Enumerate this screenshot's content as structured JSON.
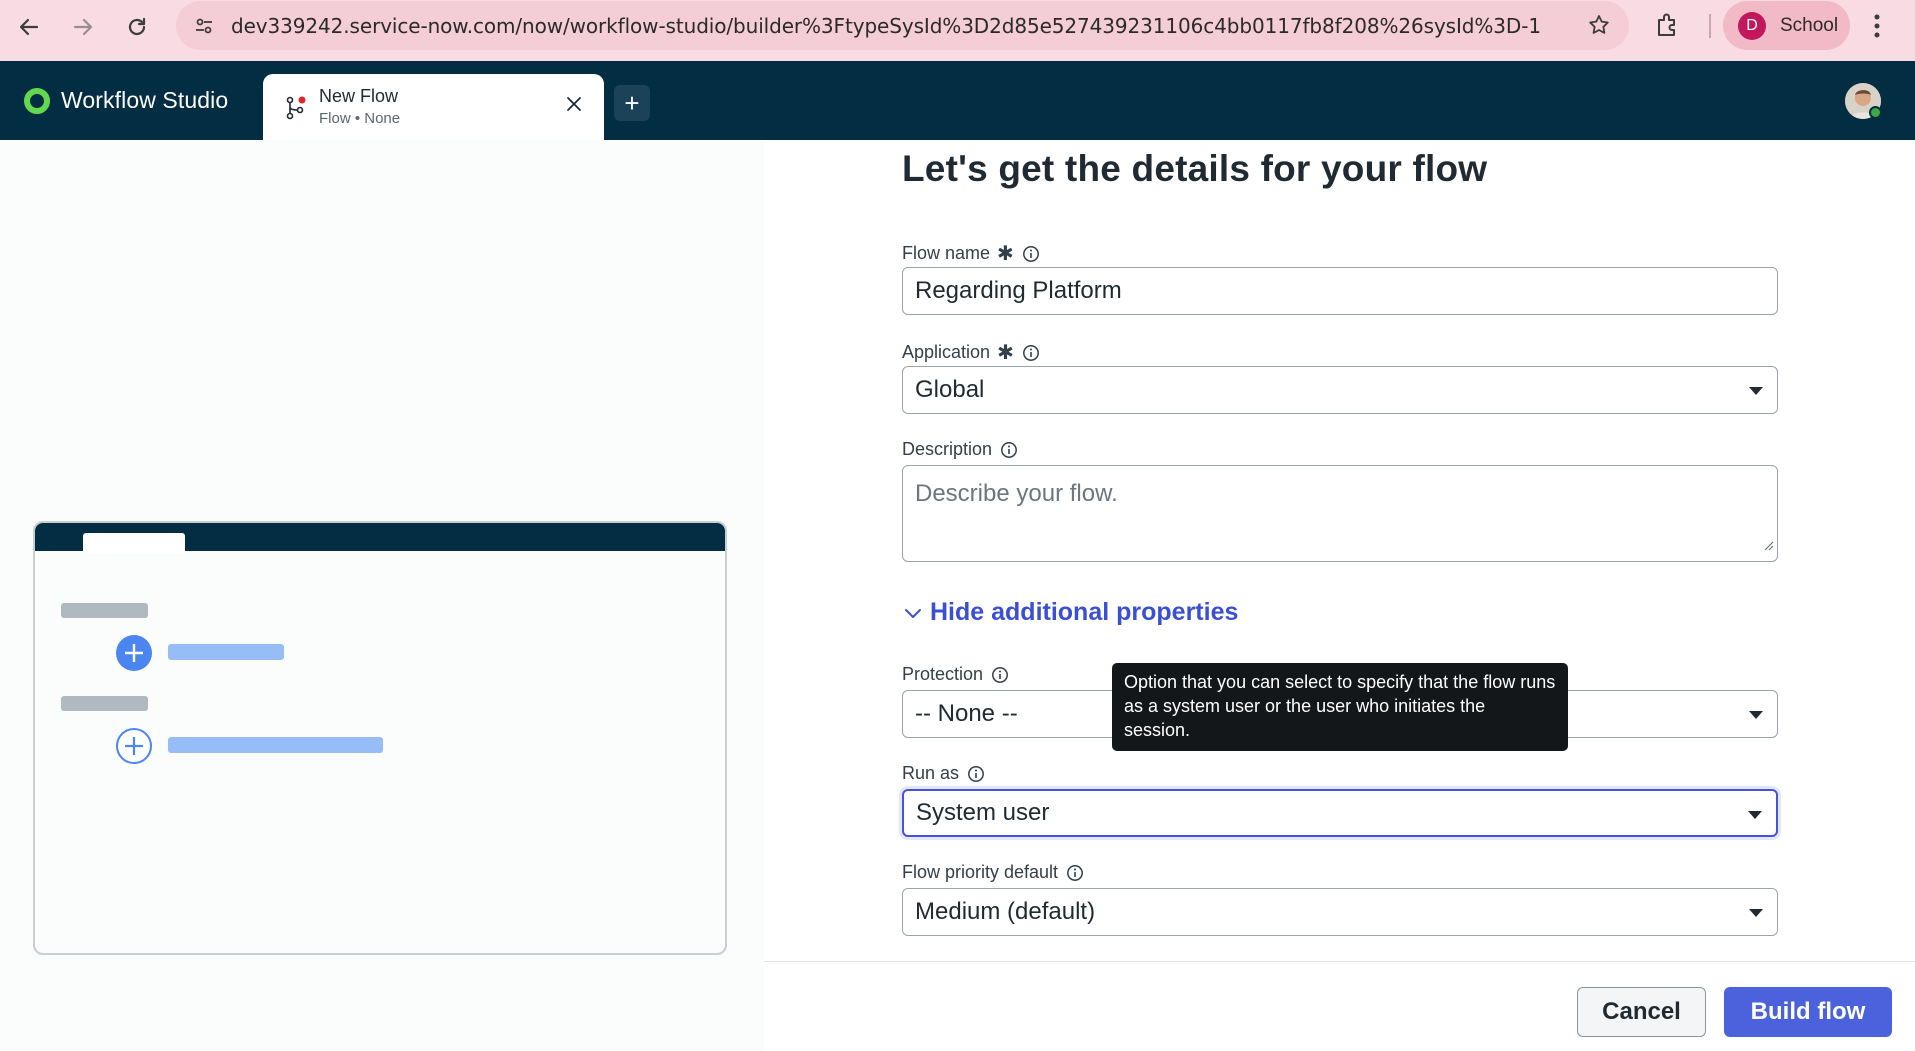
{
  "browser": {
    "url": "dev339242.service-now.com/now/workflow-studio/builder%3FtypeSysId%3D2d85e527439231106c4bb0117fb8f208%26sysId%3D-1",
    "profile_initial": "D",
    "profile_label": "School"
  },
  "app": {
    "title": "Workflow Studio",
    "tab": {
      "title": "New Flow",
      "subtitle": "Flow • None"
    },
    "add_tab": "+"
  },
  "form": {
    "heading": "Let's get the details for your flow",
    "flow_name": {
      "label": "Flow name",
      "required": "✱",
      "value": "Regarding Platform"
    },
    "application": {
      "label": "Application",
      "required": "✱",
      "value": "Global"
    },
    "description": {
      "label": "Description",
      "placeholder": "Describe your flow."
    },
    "toggle_label": "Hide additional properties",
    "protection": {
      "label": "Protection",
      "value": "-- None --"
    },
    "run_as": {
      "label": "Run as",
      "value": "System user"
    },
    "flow_priority": {
      "label": "Flow priority default",
      "value": "Medium (default)"
    },
    "tooltip": "Option that you can select to specify that the flow runs as a system user or the user who initiates the session."
  },
  "footer": {
    "cancel_label": "Cancel",
    "build_label": "Build flow"
  },
  "colors": {
    "app_header": "#032d42",
    "accent": "#4b62dc",
    "link": "#3b4fd3",
    "chrome": "#f9dbe3"
  }
}
